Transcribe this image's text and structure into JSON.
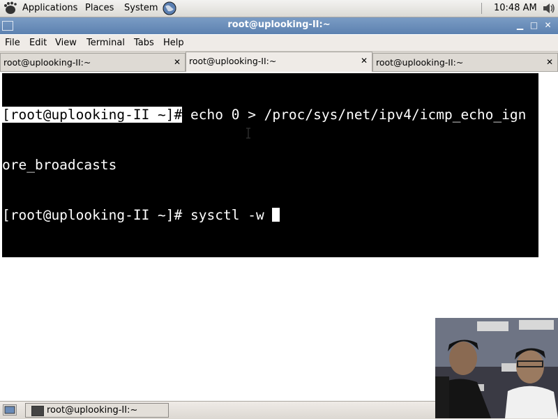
{
  "top_panel": {
    "menus": [
      "Applications",
      "Places",
      "System"
    ],
    "clock": "10:48 AM"
  },
  "window": {
    "title": "root@uplooking-II:~"
  },
  "menubar": {
    "items": [
      "File",
      "Edit",
      "View",
      "Terminal",
      "Tabs",
      "Help"
    ]
  },
  "tabs": [
    {
      "label": "root@uplooking-II:~",
      "active": false
    },
    {
      "label": "root@uplooking-II:~",
      "active": true
    },
    {
      "label": "root@uplooking-II:~",
      "active": false
    }
  ],
  "terminal": {
    "lines": [
      {
        "prompt": "[root@uplooking-II ~]#",
        "command": " echo 0 > /proc/sys/net/ipv4/icmp_echo_ign"
      },
      {
        "prompt": "",
        "command": "ore_broadcasts"
      },
      {
        "prompt": "[root@uplooking-II ~]#",
        "command": " sysctl -w "
      }
    ]
  },
  "taskbar": {
    "items": [
      {
        "label": "root@uplooking-II:~"
      }
    ]
  },
  "colors": {
    "titlebar": "#6b8fbf",
    "terminal_bg": "#000000",
    "terminal_fg": "#ffffff"
  }
}
